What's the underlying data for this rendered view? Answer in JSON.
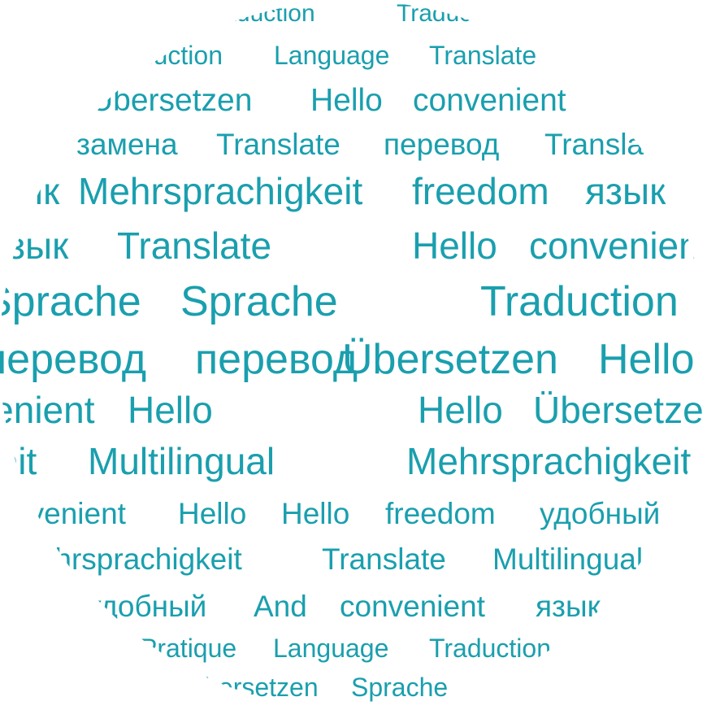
{
  "cloud": {
    "color": "#1a9fae",
    "rows": [
      [
        "Traduction",
        "Traduction"
      ],
      [
        "Traduction",
        "Language",
        "Translate"
      ],
      [
        "Übersetzen",
        "Hello",
        "convenient"
      ],
      [
        "замена",
        "Translate",
        "перевод",
        "Translate"
      ],
      [
        "язык",
        "Mehrsprachigkeit",
        "freedom",
        "язык"
      ],
      [
        "язык",
        "Translate",
        "Hello",
        "convenient"
      ],
      [
        "Sprache",
        "Sprache",
        "Traduction"
      ],
      [
        "перевод",
        "перевод",
        "Übersetzen",
        "Hello"
      ],
      [
        "convenient",
        "Hello",
        "Hello",
        "Übersetzen"
      ],
      [
        "Mehrsprachigkeit",
        "Multilingual",
        "Mehrsprachigkeit"
      ],
      [
        "convenient",
        "Hello",
        "Hello",
        "freedom",
        "удобный"
      ],
      [
        "Mehrsprachigkeit",
        "Translate",
        "Multilingual"
      ],
      [
        "удобный",
        "And",
        "convenient",
        "язык"
      ],
      [
        "Pratique",
        "Language",
        "Traduction"
      ],
      [
        "Übersetzen",
        "Sprache"
      ]
    ]
  }
}
